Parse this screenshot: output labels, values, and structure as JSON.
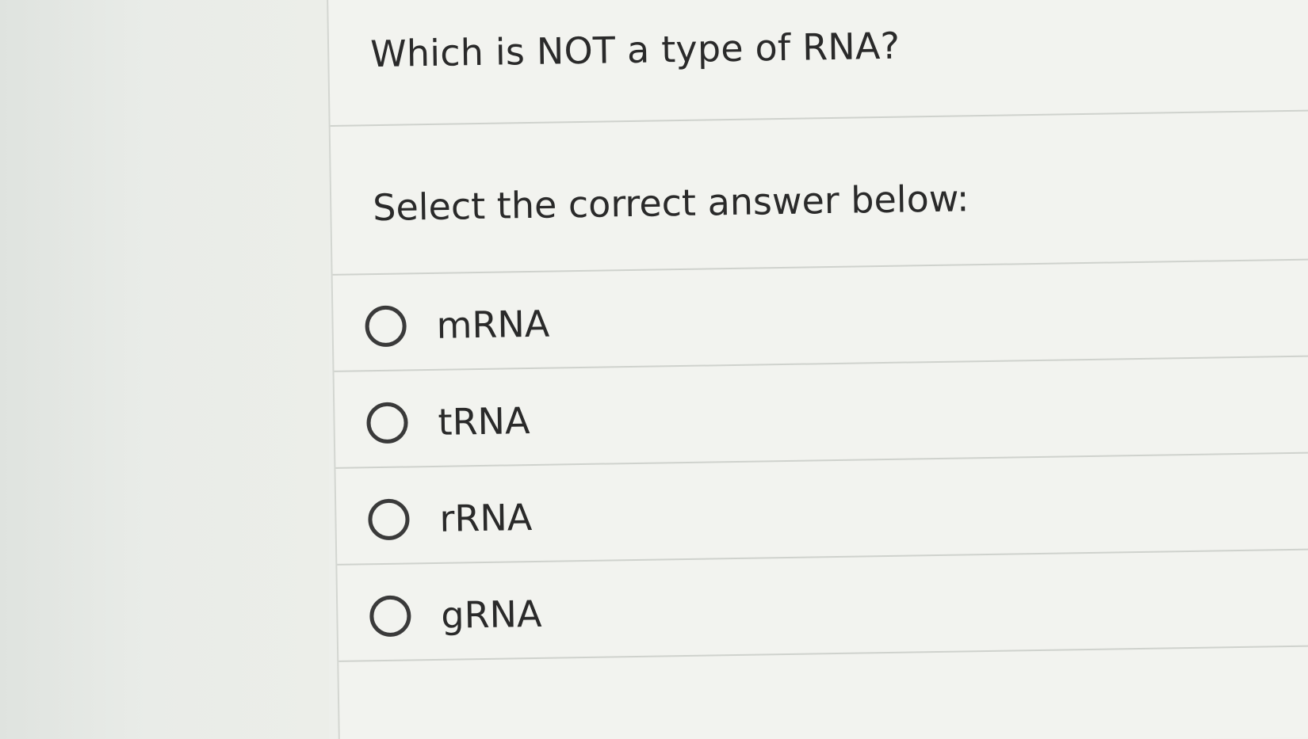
{
  "question": {
    "title": "Which is NOT a type of RNA?",
    "instruction": "Select the correct answer below:"
  },
  "options": [
    {
      "label": "mRNA",
      "selected": false
    },
    {
      "label": "tRNA",
      "selected": false
    },
    {
      "label": "rRNA",
      "selected": false
    },
    {
      "label": "gRNA",
      "selected": false
    }
  ],
  "colors": {
    "text": "#2a2a2a",
    "radio_border": "#3a3a3a",
    "divider": "#cfd2cd",
    "panel_background": "#f2f3ef"
  }
}
